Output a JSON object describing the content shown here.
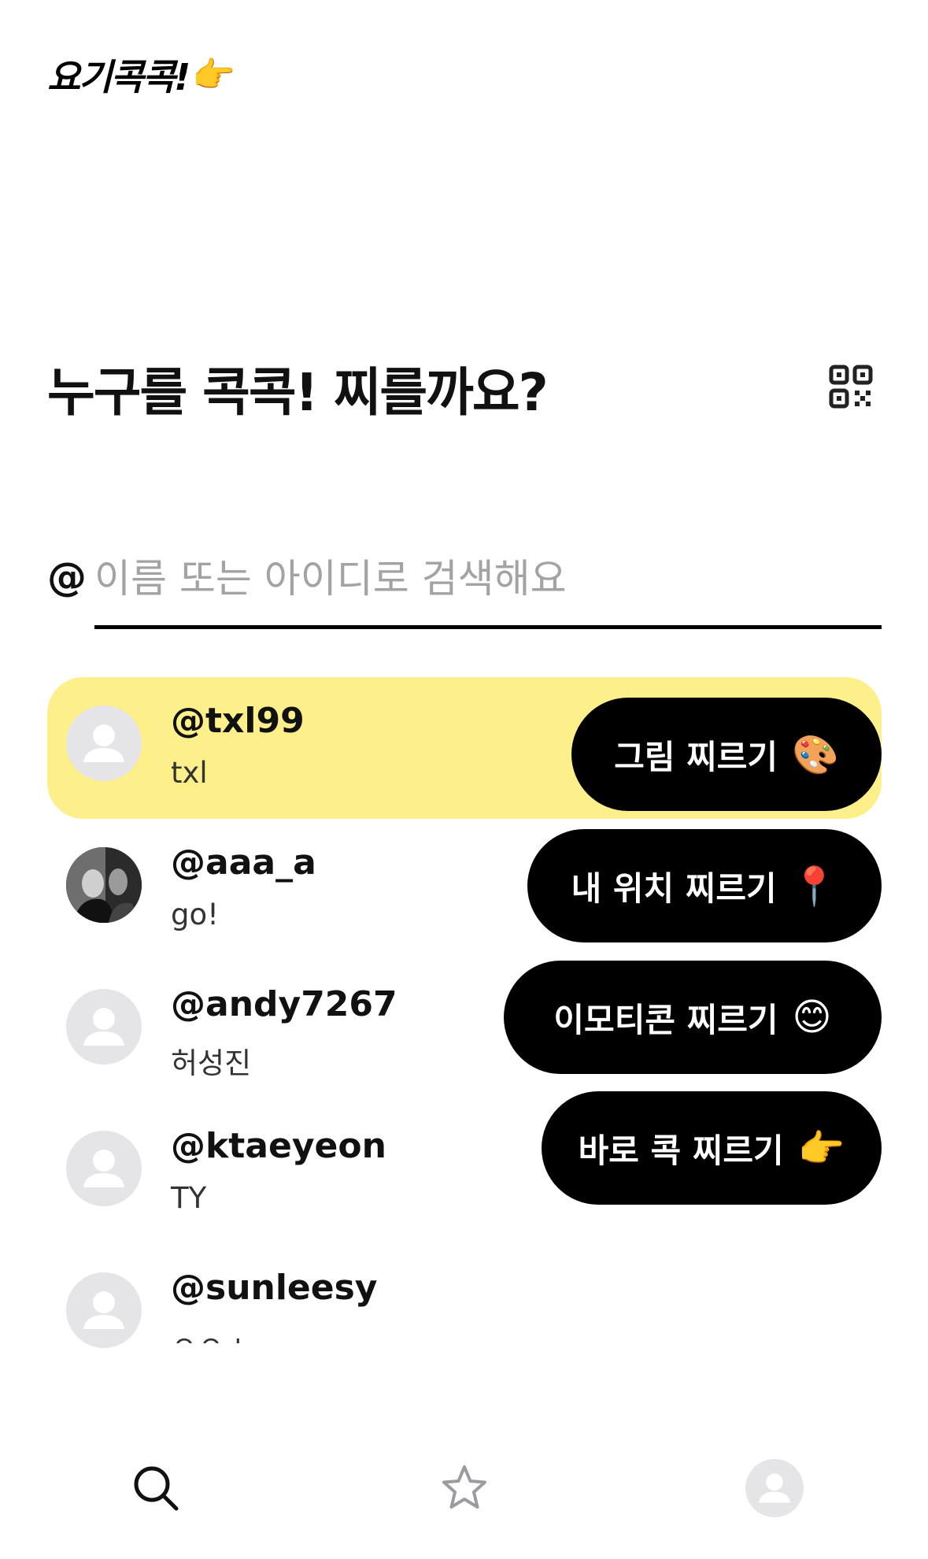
{
  "header": {
    "logo_text": "요기콕콕!",
    "logo_emoji": "👉"
  },
  "main": {
    "heading": "누구를 콕콕! 찌를까요?",
    "qr_icon": "qr-code-icon"
  },
  "search": {
    "prefix": "@",
    "placeholder": "이름 또는 아이디로 검색해요",
    "value": ""
  },
  "users": [
    {
      "handle": "@txl99",
      "name": "txl",
      "selected": true,
      "avatar": "default-avatar"
    },
    {
      "handle": "@aaa_a",
      "name": "go!",
      "selected": false,
      "avatar": "photo-avatar"
    },
    {
      "handle": "@andy7267",
      "name": "허성진",
      "selected": false,
      "avatar": "default-avatar"
    },
    {
      "handle": "@ktaeyeon",
      "name": "TY",
      "selected": false,
      "avatar": "default-avatar"
    },
    {
      "handle": "@sunleesy",
      "name": "ㅇㅇㅅ",
      "selected": false,
      "avatar": "default-avatar"
    }
  ],
  "poke_menu": [
    {
      "label": "그림 찌르기",
      "emoji": "🎨"
    },
    {
      "label": "내 위치 찌르기",
      "emoji": "📍"
    },
    {
      "label": "이모티콘 찌르기",
      "emoji": "😊"
    },
    {
      "label": "바로 콕 찌르기",
      "emoji": "👉"
    }
  ],
  "tabbar": {
    "items": [
      {
        "icon": "search-icon",
        "active": true
      },
      {
        "icon": "star-icon",
        "active": false
      },
      {
        "icon": "profile-icon",
        "active": false
      }
    ]
  },
  "colors": {
    "selected_row": "#fdef8a",
    "poke_button_bg": "#000000",
    "placeholder": "#a3a3a3"
  }
}
